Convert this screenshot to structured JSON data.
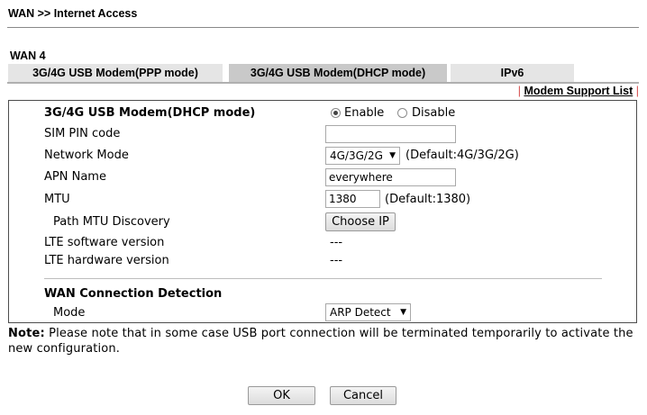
{
  "breadcrumb": "WAN >> Internet Access",
  "section_title": "WAN 4",
  "tabs": [
    {
      "label": "3G/4G USB Modem(PPP mode)",
      "active": false
    },
    {
      "label": "3G/4G USB Modem(DHCP mode)",
      "active": true
    },
    {
      "label": "IPv6",
      "active": false
    }
  ],
  "modem_link": {
    "pipe": "|",
    "label": "Modem Support List"
  },
  "form": {
    "heading": "3G/4G USB Modem(DHCP mode)",
    "enable_label": "Enable",
    "disable_label": "Disable",
    "enabled": true,
    "sim_pin_label": "SIM PIN code",
    "sim_pin_value": "",
    "network_mode_label": "Network Mode",
    "network_mode_value": "4G/3G/2G",
    "network_mode_default": "(Default:4G/3G/2G)",
    "apn_label": "APN Name",
    "apn_value": "everywhere",
    "mtu_label": "MTU",
    "mtu_value": "1380",
    "mtu_default": "(Default:1380)",
    "path_mtu_label": "Path MTU Discovery",
    "choose_ip_label": "Choose IP",
    "lte_sw_label": "LTE software version",
    "lte_sw_value": "---",
    "lte_hw_label": "LTE hardware version",
    "lte_hw_value": "---",
    "detection_heading": "WAN Connection Detection",
    "mode_label": "Mode",
    "mode_value": "ARP Detect"
  },
  "note": {
    "prefix": "Note:",
    "text": "Please note that in some case USB port connection will be terminated temporarily to activate the new configuration."
  },
  "buttons": {
    "ok": "OK",
    "cancel": "Cancel"
  }
}
